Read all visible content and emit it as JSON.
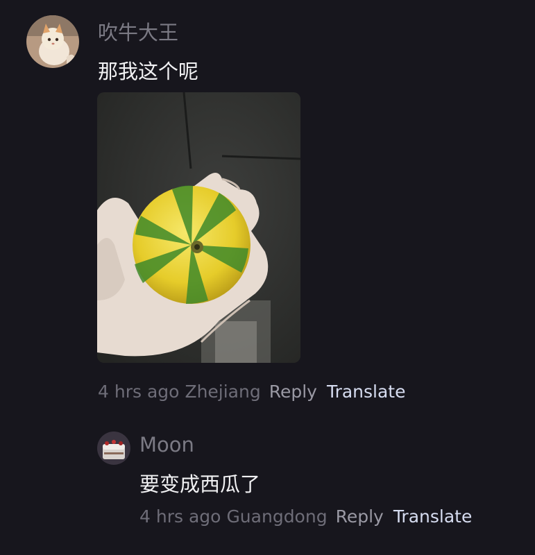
{
  "comment": {
    "username": "吹牛大王",
    "text": "那我这个呢",
    "time": "4 hrs ago",
    "location": "Zhejiang",
    "reply_label": "Reply",
    "translate_label": "Translate",
    "avatar_icon": "cat-avatar",
    "image_icon": "hand-holding-watermelon-orange-photo"
  },
  "reply": {
    "username": "Moon",
    "text": "要变成西瓜了",
    "time": "4 hrs ago",
    "location": "Guangdong",
    "reply_label": "Reply",
    "translate_label": "Translate",
    "avatar_icon": "cake-avatar"
  },
  "colors": {
    "background": "#17161d",
    "username": "#7b7a84",
    "text": "#f1f1f3",
    "meta": "#6e6d78",
    "translate": "#d6dcf0"
  }
}
